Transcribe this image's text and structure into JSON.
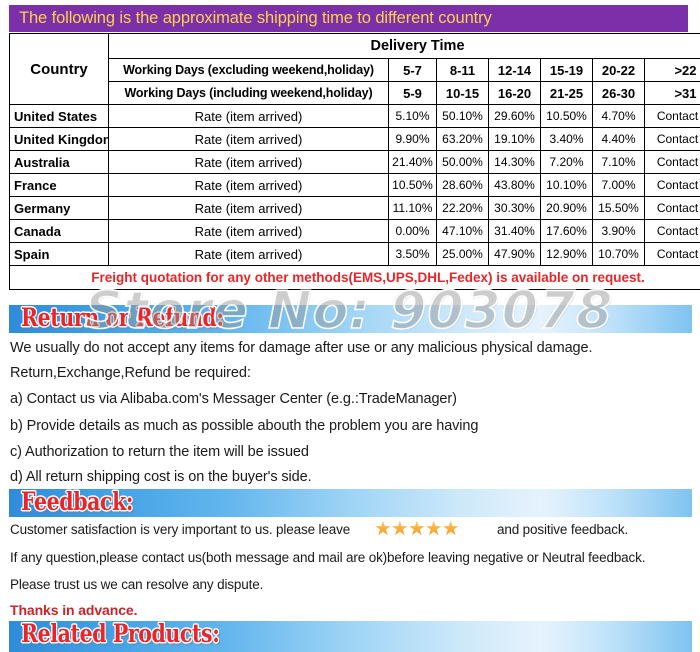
{
  "title_banner": {
    "text": "The following is the approximate shipping time to different country"
  },
  "shipping_table": {
    "country_header": "Country",
    "delivery_time_header": "Delivery Time",
    "working_days_excluding": "Working Days (excluding weekend,holiday)",
    "working_days_including": "Working Days (including weekend,holiday)",
    "ranges_excluding": [
      "5-7",
      "8-11",
      "12-14",
      "15-19",
      "20-22",
      ">22"
    ],
    "ranges_including": [
      "5-9",
      "10-15",
      "16-20",
      "21-25",
      "26-30",
      ">31"
    ],
    "rate_label": "Rate (item arrived)",
    "contact_label": "Contact us",
    "rows": [
      {
        "country": "United States",
        "rates": [
          "5.10%",
          "50.10%",
          "29.60%",
          "10.50%",
          "4.70%"
        ]
      },
      {
        "country": "United Kingdon",
        "rates": [
          "9.90%",
          "63.20%",
          "19.10%",
          "3.40%",
          "4.40%"
        ]
      },
      {
        "country": "Australia",
        "rates": [
          "21.40%",
          "50.00%",
          "14.30%",
          "7.20%",
          "7.10%"
        ]
      },
      {
        "country": "France",
        "rates": [
          "10.50%",
          "28.60%",
          "43.80%",
          "10.10%",
          "7.00%"
        ]
      },
      {
        "country": "Germany",
        "rates": [
          "11.10%",
          "22.20%",
          "30.30%",
          "20.90%",
          "15.50%"
        ]
      },
      {
        "country": "Canada",
        "rates": [
          "0.00%",
          "47.10%",
          "31.40%",
          "17.60%",
          "3.90%"
        ]
      },
      {
        "country": "Spain",
        "rates": [
          "3.50%",
          "25.00%",
          "47.90%",
          "12.90%",
          "10.70%"
        ]
      }
    ],
    "freight_note": "Freight quotation for any other methods(EMS,UPS,DHL,Fedex) is available on request."
  },
  "watermark": {
    "text": "Store No: 903078"
  },
  "return_section": {
    "banner": "Return or Refund:",
    "lines": [
      "We usually do not accept any items for damage after use or any malicious physical damage.",
      "Return,Exchange,Refund be required:",
      "a) Contact us via Alibaba.com's Messager Center (e.g.:TradeManager)",
      "b) Provide details as much as possible abouth the problem you are having",
      "c) Authorization to return the item will be issued",
      "d) All return shipping cost is on the buyer's side."
    ]
  },
  "feedback_section": {
    "banner": "Feedback:",
    "line1_before_stars": "Customer satisfaction is very important to us. please leave",
    "stars": "★★★★★",
    "star_count": 5,
    "line1_after_stars": "and positive feedback.",
    "line2": "If any question,please contact us(both message and mail are ok)before leaving negative or Neutral feedback.",
    "line3": "Please trust us we can resolve any dispute.",
    "line4_thanks": "Thanks in advance."
  },
  "related_section": {
    "banner": "Related Products:"
  },
  "colors": {
    "title_banner_bg": "#7B2FA8",
    "title_banner_text": "#FFD24A",
    "banner_red": "#E8262A",
    "freight_red": "#E8262A",
    "thanks_red": "#C9252B",
    "star_gold": "#F5A623"
  }
}
